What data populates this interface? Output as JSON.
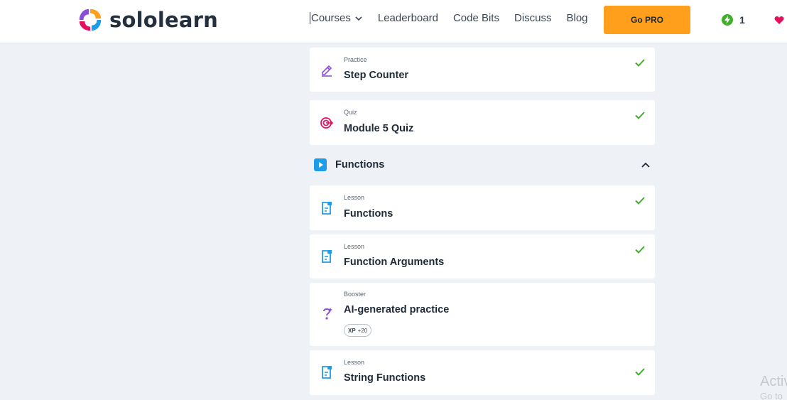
{
  "brand": {
    "name": "sololearn"
  },
  "nav": {
    "items": [
      "Courses",
      "Leaderboard",
      "Code Bits",
      "Discuss",
      "Blog"
    ],
    "cta": "Go PRO",
    "streak_count": "1"
  },
  "items": [
    {
      "type": "Practice",
      "title": "Step Counter",
      "icon": "pencil-icon",
      "completed": true
    },
    {
      "type": "Quiz",
      "title": "Module 5 Quiz",
      "icon": "target-icon",
      "completed": true
    }
  ],
  "section": {
    "title": "Functions",
    "expanded": true
  },
  "section_items": [
    {
      "type": "Lesson",
      "title": "Functions",
      "icon": "lesson-icon",
      "completed": true
    },
    {
      "type": "Lesson",
      "title": "Function Arguments",
      "icon": "lesson-icon",
      "completed": true
    },
    {
      "type": "Booster",
      "title": "AI-generated practice",
      "icon": "question-icon",
      "completed": false,
      "badge_label": "XP",
      "badge_value": "+20"
    },
    {
      "type": "Lesson",
      "title": "String Functions",
      "icon": "lesson-icon",
      "completed": true
    }
  ],
  "watermark": {
    "line1": "Activ",
    "line2": "Go to"
  },
  "colors": {
    "accent": "#ff9f1c",
    "check": "#3fae2a",
    "lesson": "#1e9ce8",
    "practice": "#8a4fd6",
    "quiz": "#e5105e"
  }
}
